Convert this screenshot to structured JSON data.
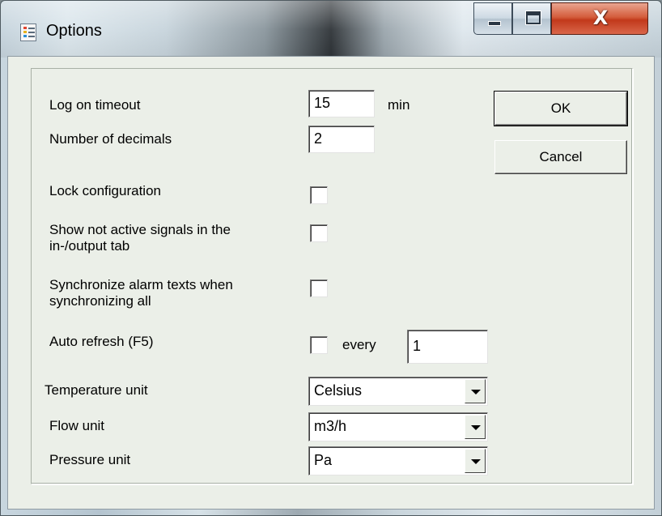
{
  "window": {
    "title": "Options",
    "minimize_icon": "minimize-icon",
    "maximize_icon": "maximize-icon",
    "close_label": "X"
  },
  "form": {
    "log_on_timeout": {
      "label": "Log on timeout",
      "value": "15",
      "unit": "min"
    },
    "number_of_decimals": {
      "label": "Number of decimals",
      "value": "2"
    },
    "lock_configuration": {
      "label": "Lock configuration",
      "checked": false
    },
    "show_not_active": {
      "label_line1": "Show not active signals in the",
      "label_line2": "in-/output tab",
      "checked": false
    },
    "synchronize_alarm": {
      "label_line1": "Synchronize alarm texts when",
      "label_line2": "synchronizing all",
      "checked": false
    },
    "auto_refresh": {
      "label": "Auto refresh (F5)",
      "checked": false,
      "every_label": "every",
      "value": "1"
    },
    "temperature_unit": {
      "label": "Temperature unit",
      "selected": "Celsius"
    },
    "flow_unit": {
      "label": "Flow unit",
      "selected": "m3/h"
    },
    "pressure_unit": {
      "label": "Pressure unit",
      "selected": "Pa"
    }
  },
  "buttons": {
    "ok": "OK",
    "cancel": "Cancel"
  }
}
